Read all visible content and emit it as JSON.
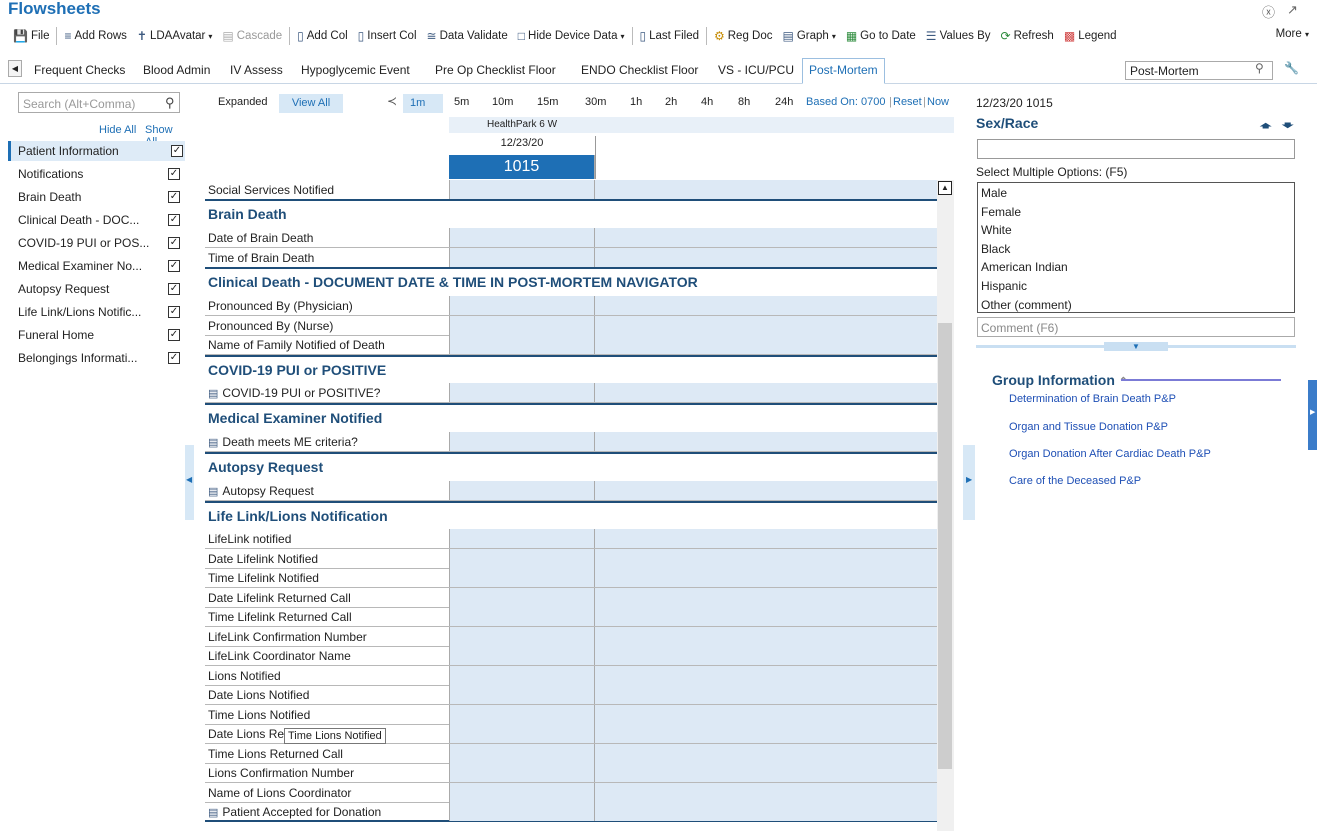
{
  "app": {
    "title": "Flowsheets"
  },
  "toolbar": {
    "file": "File",
    "add_rows": "Add Rows",
    "lda_avatar": "LDAAvatar",
    "cascade": "Cascade",
    "add_col": "Add Col",
    "insert_col": "Insert Col",
    "data_validate": "Data Validate",
    "hide_device_data": "Hide Device Data",
    "last_filed": "Last Filed",
    "reg_doc": "Reg Doc",
    "graph": "Graph",
    "go_to_date": "Go to Date",
    "values_by": "Values By",
    "refresh": "Refresh",
    "legend": "Legend",
    "more": "More"
  },
  "tabs": [
    "Frequent Checks",
    "Blood Admin",
    "IV Assess",
    "Hypoglycemic Event",
    "Pre Op Checklist Floor",
    "ENDO Checklist Floor",
    "VS - ICU/PCU",
    "Post-Mortem"
  ],
  "tab_search_value": "Post-Mortem",
  "nav": {
    "search_placeholder": "Search (Alt+Comma)",
    "hide_all": "Hide All",
    "show_all": "Show All",
    "items": [
      "Patient Information",
      "Notifications",
      "Brain Death",
      "Clinical Death - DOC...",
      "COVID-19 PUI or POS...",
      "Medical Examiner No...",
      "Autopsy Request",
      "Life Link/Lions Notific...",
      "Funeral Home",
      "Belongings Informati..."
    ]
  },
  "grid_header": {
    "expanded": "Expanded",
    "view_all": "View All",
    "intervals": [
      "1m",
      "5m",
      "10m",
      "15m",
      "30m",
      "1h",
      "2h",
      "4h",
      "8h",
      "24h"
    ],
    "based_on": "Based On: 0700",
    "reset": "Reset",
    "now": "Now",
    "location": "HealthPark 6 W",
    "date": "12/23/20",
    "time": "1015"
  },
  "grid": {
    "row_social": "Social Services Notified",
    "sec_brain": "Brain Death",
    "row_date_brain": "Date of Brain Death",
    "row_time_brain": "Time of Brain Death",
    "sec_clinical": "Clinical Death - DOCUMENT DATE & TIME IN POST-MORTEM NAVIGATOR",
    "row_pron_phys": "Pronounced By (Physician)",
    "row_pron_nurse": "Pronounced By (Nurse)",
    "row_family": "Name of Family Notified of Death",
    "sec_covid": "COVID-19 PUI or POSITIVE",
    "row_covid": "COVID-19 PUI or POSITIVE?",
    "sec_me": "Medical Examiner Notified",
    "row_me": "Death meets ME criteria?",
    "sec_autopsy": "Autopsy Request",
    "row_autopsy": "Autopsy Request",
    "sec_lifelink": "Life Link/Lions Notification",
    "row_ll_notified": "LifeLink notified",
    "row_ll_date": "Date Lifelink Notified",
    "row_ll_time": "Time Lifelink Notified",
    "row_ll_date_ret": "Date Lifelink Returned Call",
    "row_ll_time_ret": "Time Lifelink Returned Call",
    "row_ll_conf": "LifeLink Confirmation Number",
    "row_ll_coord": "LifeLink Coordinator Name",
    "row_lions_notified": "Lions Notified",
    "row_lions_date": "Date Lions Notified",
    "row_lions_time": "Time Lions Notified",
    "row_lions_date_ret": "Date Lions Re",
    "row_lions_time_ret": "Time Lions Returned Call",
    "row_lions_conf": "Lions Confirmation Number",
    "row_lions_coord": "Name of Lions Coordinator",
    "row_accepted": "Patient Accepted for Donation"
  },
  "tooltip": "Time Lions Notified",
  "right_panel": {
    "datetime": "12/23/20 1015",
    "title": "Sex/Race",
    "multi_label": "Select Multiple Options: (F5)",
    "options": [
      "Male",
      "Female",
      "White",
      "Black",
      "American Indian",
      "Hispanic",
      "Other (comment)"
    ],
    "comment_placeholder": "Comment (F6)",
    "group_title": "Group Information",
    "group_links": [
      "Determination of Brain Death P&P",
      "Organ and Tissue Donation P&P",
      "Organ Donation After Cardiac Death P&P",
      "Care of the Deceased P&P"
    ]
  },
  "icons": {
    "help": "help-icon",
    "expand": "expand-icon",
    "search": "search-icon",
    "wrench": "wrench-icon",
    "checkbox": "checkbox-checked",
    "up": "arrow-up-icon",
    "down": "arrow-down-icon"
  },
  "colors": {
    "accent": "#1e6fb5",
    "section": "#1f4e79",
    "cell": "#dde9f5",
    "link": "#1e4fb5"
  }
}
